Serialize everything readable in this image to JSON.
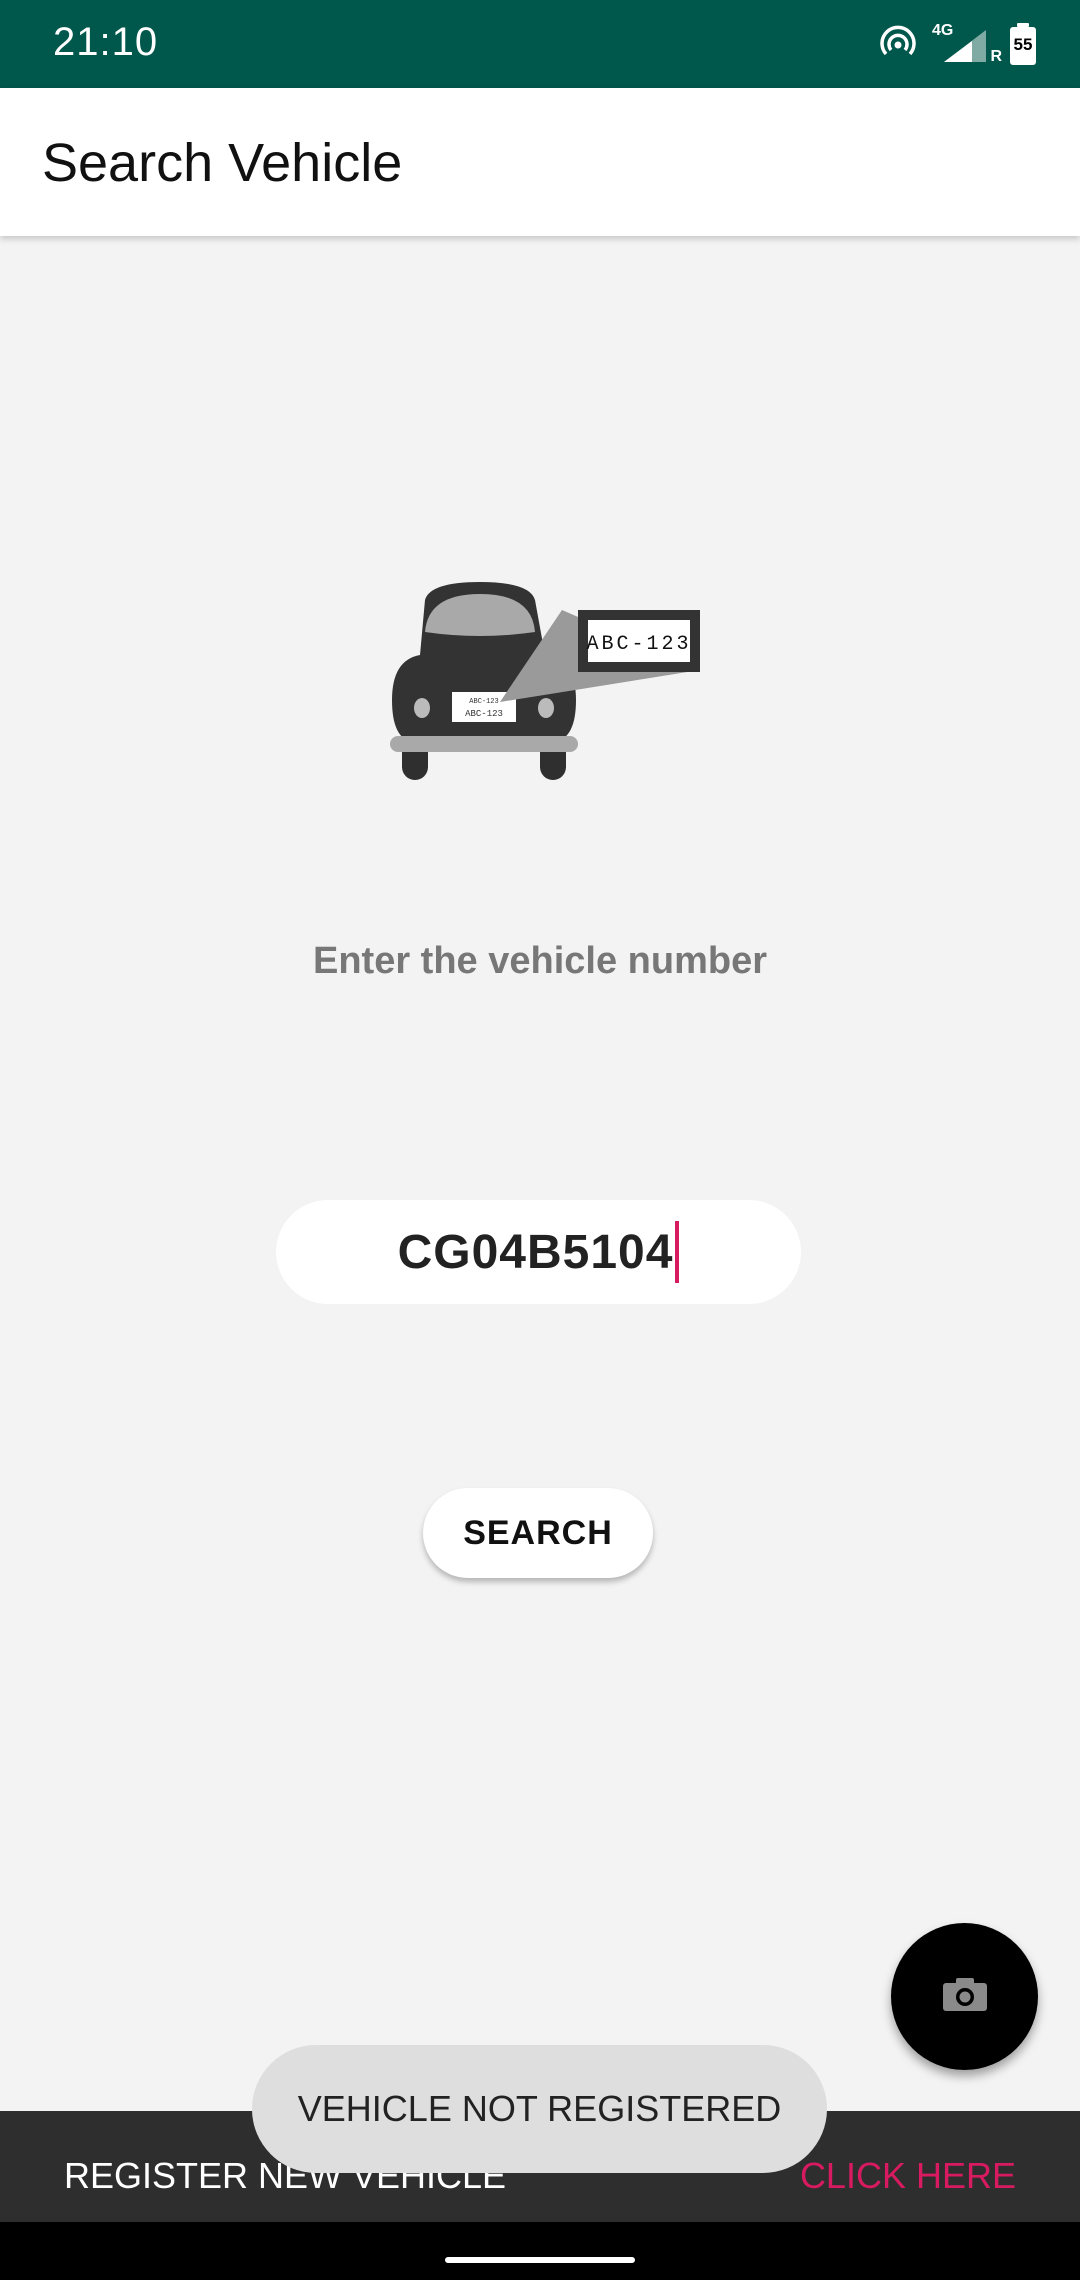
{
  "status_bar": {
    "time": "21:10",
    "network_label": "4G",
    "roaming_label": "R",
    "battery_level": "55"
  },
  "app_bar": {
    "title": "Search Vehicle"
  },
  "illustration": {
    "plate_text": "ABC-123",
    "small_plate_text": "ABC-123"
  },
  "main": {
    "prompt": "Enter the vehicle number",
    "input_value": "CG04B5104",
    "search_label": "SEARCH"
  },
  "fab": {
    "icon": "camera-icon"
  },
  "bottom_bar": {
    "register_label": "REGISTER NEW VEHICLE",
    "action_label": "CLICK HERE"
  },
  "toast": {
    "message": "VEHICLE NOT REGISTERED"
  },
  "colors": {
    "status_bar": "#00574b",
    "accent": "#d81b60",
    "bottom_bar": "#2e2e2e"
  }
}
